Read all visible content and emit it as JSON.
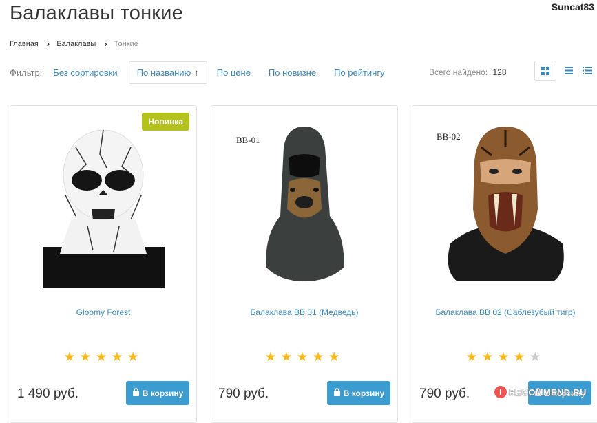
{
  "page": {
    "title": "Балаклавы тонкие",
    "user_watermark": "Suncat83"
  },
  "breadcrumb": [
    {
      "label": "Главная"
    },
    {
      "label": "Балаклавы"
    },
    {
      "label": "Тонкие"
    }
  ],
  "filter": {
    "label": "Фильтр:",
    "options": [
      "Без сортировки",
      "По названию",
      "По цене",
      "По новизне",
      "По рейтингу"
    ],
    "active": "По названию",
    "sort_arrow": "↑"
  },
  "results": {
    "label": "Всего найдено:",
    "count": "128"
  },
  "view_modes": [
    "grid-view-icon",
    "list-view-icon",
    "detailed-list-view-icon"
  ],
  "colors": {
    "link": "#3a87b7",
    "button": "#3c9ccf",
    "badge": "#b5c21c",
    "star": "#f6b91d"
  },
  "products": [
    {
      "name": "Gloomy Forest",
      "badge": "Новинка",
      "code": "",
      "rating": 5,
      "price": "1 490 руб.",
      "cta": "В корзину"
    },
    {
      "name": "Балаклава BB 01 (Медведь)",
      "badge": "",
      "code": "BB-01",
      "rating": 5,
      "price": "790 руб.",
      "cta": "В корзину"
    },
    {
      "name": "Балаклава BB 02 (Саблезубый тигр)",
      "badge": "",
      "code": "BB-02",
      "rating": 4,
      "price": "790 руб.",
      "cta": "В корзину"
    }
  ],
  "watermark": {
    "text": "RECOMMEND.RU",
    "logo_letter": "I"
  }
}
